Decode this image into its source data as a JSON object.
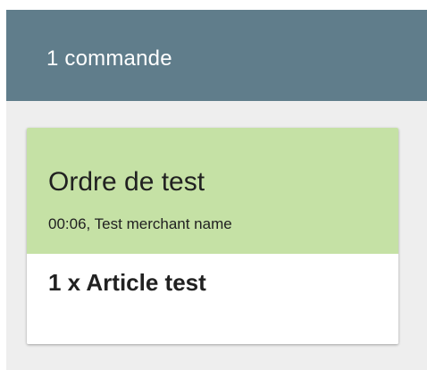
{
  "header": {
    "title": "1 commande"
  },
  "order": {
    "title": "Ordre de test",
    "subtitle": "00:06, Test merchant name",
    "items": [
      {
        "line": "1 x Article test"
      }
    ]
  },
  "colors": {
    "header_bg": "#607d8b",
    "panel_bg": "#eeeeee",
    "card_head_bg": "#c5e1a5",
    "card_body_bg": "#ffffff"
  }
}
